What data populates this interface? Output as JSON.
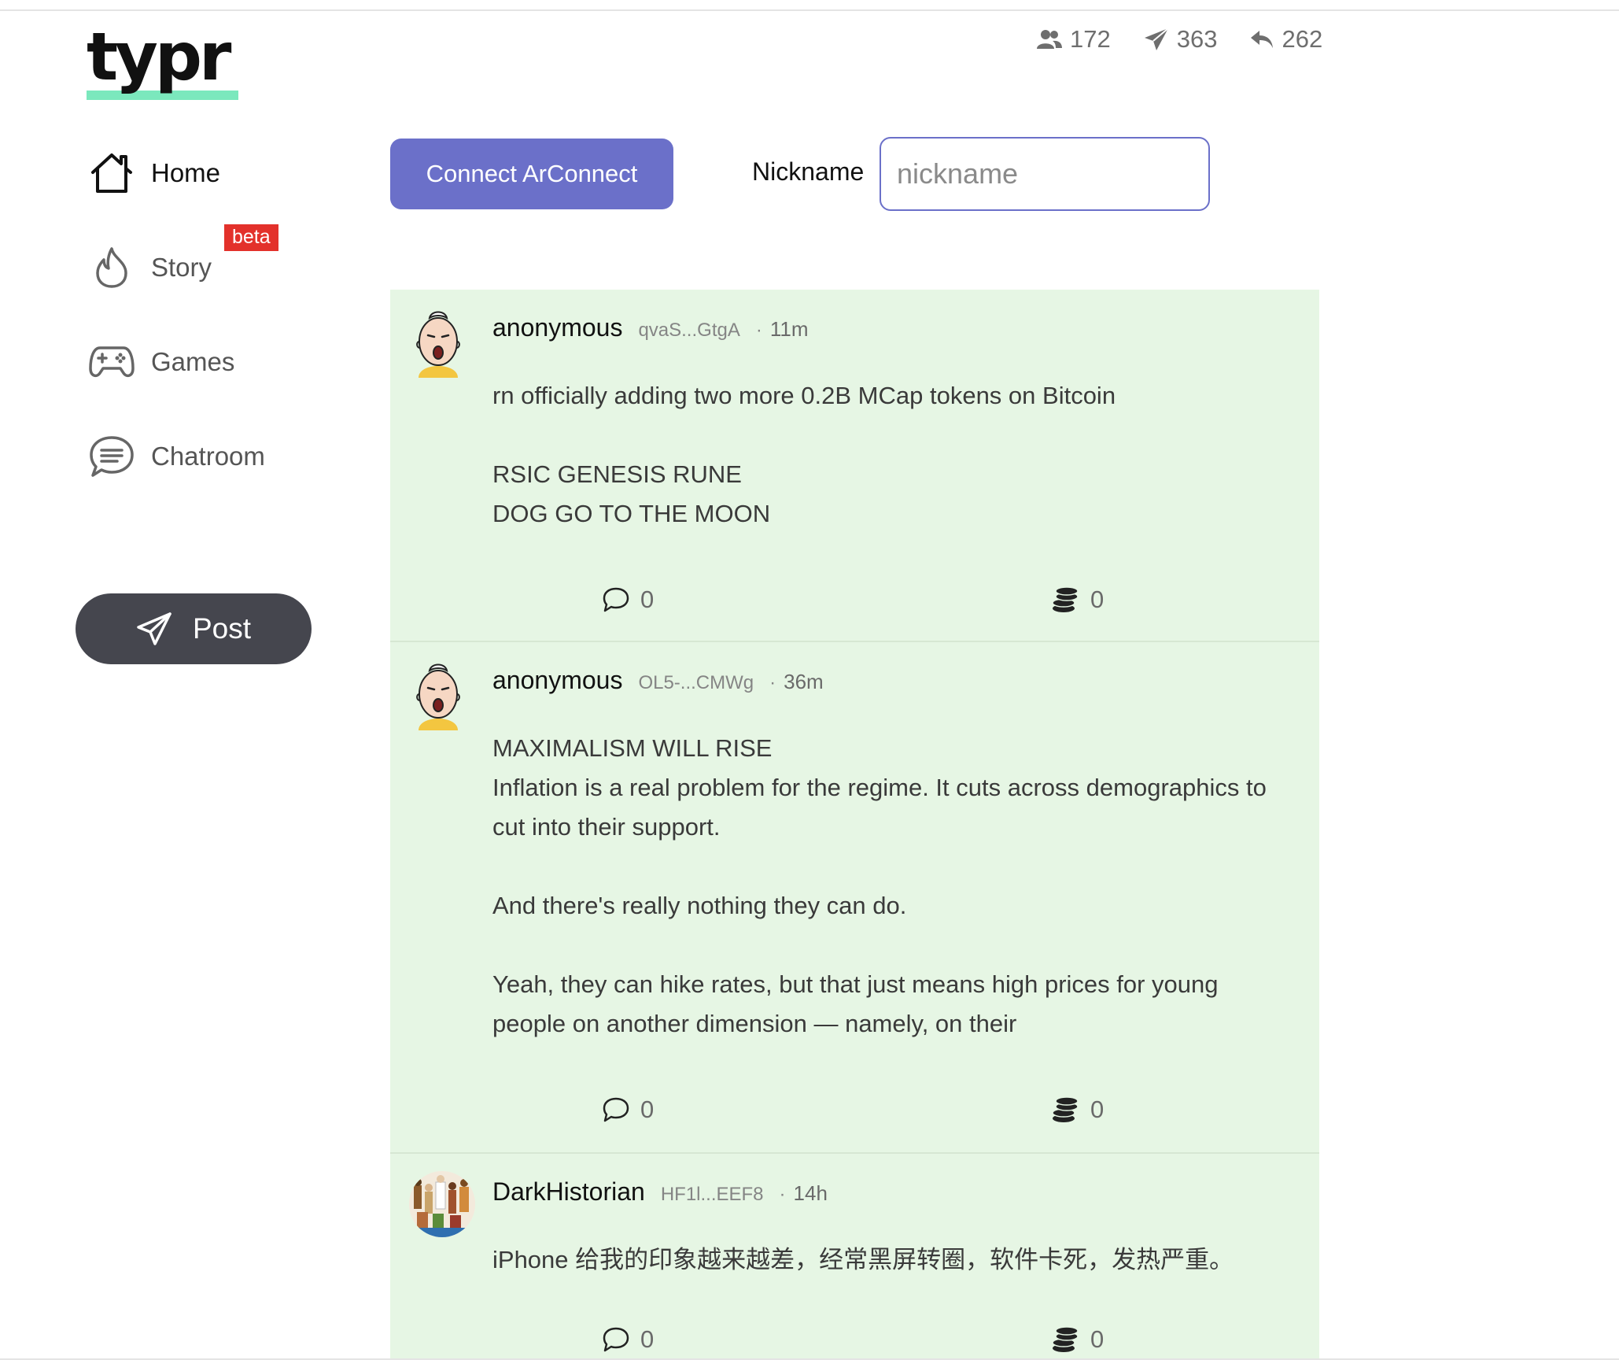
{
  "app": {
    "logo_text": "typr"
  },
  "stats": [
    {
      "icon": "users-icon",
      "value": "172"
    },
    {
      "icon": "send-icon",
      "value": "363"
    },
    {
      "icon": "reply-icon",
      "value": "262"
    }
  ],
  "sidebar": {
    "items": [
      {
        "label": "Home",
        "icon": "home-icon",
        "active": true
      },
      {
        "label": "Story",
        "icon": "flame-icon",
        "badge": "beta"
      },
      {
        "label": "Games",
        "icon": "gamepad-icon"
      },
      {
        "label": "Chatroom",
        "icon": "chat-icon"
      }
    ],
    "post_button_label": "Post"
  },
  "connect": {
    "button_label": "Connect ArConnect",
    "nickname_label": "Nickname",
    "nickname_placeholder": "nickname",
    "nickname_value": ""
  },
  "colors": {
    "accent": "#6b70c9",
    "feed_background": "#e6f6e4",
    "post_button": "#45464e",
    "badge": "#e3312b",
    "logo_underline": "#7be8bd"
  },
  "feed": {
    "posts": [
      {
        "author": "anonymous",
        "address": "qvaS...GtgA",
        "separator": "·",
        "time": "11m",
        "avatar": "cartoon-face-avatar",
        "lines": [
          "rn officially adding two more 0.2B MCap tokens on Bitcoin",
          "",
          "RSIC GENESIS RUNE",
          "DOG GO TO THE MOON"
        ],
        "comments": "0",
        "tips": "0"
      },
      {
        "author": "anonymous",
        "address": "OL5-...CMWg",
        "separator": "·",
        "time": "36m",
        "avatar": "cartoon-face-avatar",
        "lines": [
          "MAXIMALISM WILL RISE",
          "Inflation is a real problem for the regime. It cuts across demographics to",
          "cut into their support.",
          "",
          "And there's really nothing they can do.",
          "",
          "Yeah, they can hike rates, but that just means high prices for young",
          "people on another dimension — namely, on their"
        ],
        "comments": "0",
        "tips": "0"
      },
      {
        "author": "DarkHistorian",
        "address": "HF1l...EEF8",
        "separator": "·",
        "time": "14h",
        "avatar": "illustrated-crowd-avatar",
        "lines": [
          "iPhone 给我的印象越来越差，经常黑屏转圈，软件卡死，发热严重。"
        ],
        "comments": "0",
        "tips": "0"
      }
    ]
  }
}
